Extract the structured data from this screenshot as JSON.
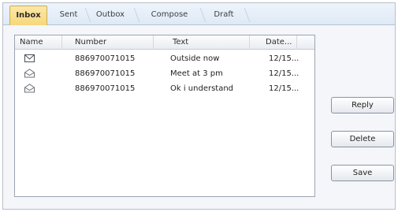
{
  "tabs": [
    {
      "label": "Inbox"
    },
    {
      "label": "Sent"
    },
    {
      "label": "Outbox"
    },
    {
      "label": "Compose"
    },
    {
      "label": "Draft"
    }
  ],
  "table": {
    "columns": [
      "Name",
      "Number",
      "Text",
      "Date..."
    ],
    "rows": [
      {
        "icon": "unread-envelope-icon",
        "number": "886970071015",
        "text": "Outside now",
        "date": "12/15..."
      },
      {
        "icon": "read-envelope-icon",
        "number": "886970071015",
        "text": "Meet at 3 pm",
        "date": "12/15..."
      },
      {
        "icon": "read-envelope-icon",
        "number": "886970071015",
        "text": "Ok i understand",
        "date": "12/15..."
      }
    ]
  },
  "buttons": {
    "reply": "Reply",
    "delete": "Delete",
    "save": "Save"
  }
}
